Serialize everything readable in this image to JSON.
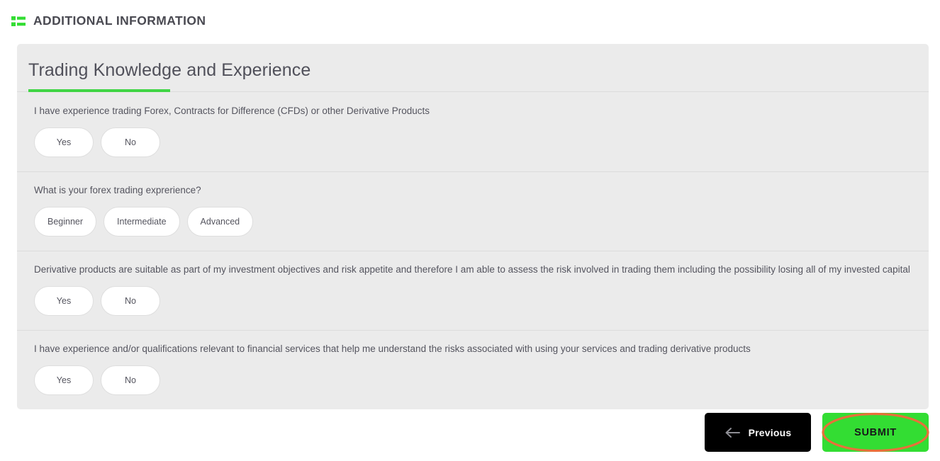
{
  "header": {
    "icon": "list-icon",
    "title": "ADDITIONAL INFORMATION"
  },
  "card": {
    "title": "Trading Knowledge and Experience",
    "accent_color": "#40d545",
    "background": "#ebebeb"
  },
  "questions": [
    {
      "text": "I have experience trading Forex, Contracts for Difference (CFDs) or other Derivative Products",
      "options": [
        "Yes",
        "No"
      ]
    },
    {
      "text": "What is your forex trading exprerience?",
      "options": [
        "Beginner",
        "Intermediate",
        "Advanced"
      ]
    },
    {
      "text": "Derivative products are suitable as part of my investment objectives and risk appetite and therefore I am able to assess the risk involved in trading them including the possibility losing all of my invested capital",
      "options": [
        "Yes",
        "No"
      ]
    },
    {
      "text": "I have experience and/or qualifications relevant to financial services that help me understand the risks associated with using your services and trading derivative products",
      "options": [
        "Yes",
        "No"
      ]
    }
  ],
  "footer": {
    "previous_label": "Previous",
    "previous_icon": "arrow-left-icon",
    "submit_label": "SUBMIT",
    "submit_color": "#33dd33",
    "annotation_color": "#e8703a"
  }
}
